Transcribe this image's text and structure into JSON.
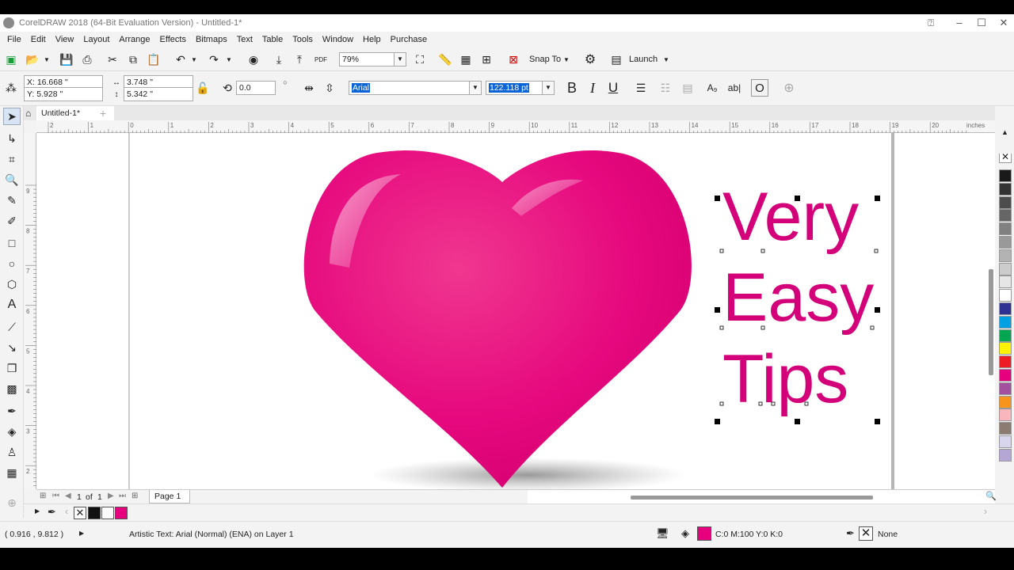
{
  "window": {
    "title": "CorelDRAW 2018 (64-Bit Evaluation Version) - Untitled-1*",
    "buttons": [
      "–",
      "☐",
      "✕"
    ]
  },
  "menu": [
    "File",
    "Edit",
    "View",
    "Layout",
    "Arrange",
    "Effects",
    "Bitmaps",
    "Text",
    "Table",
    "Tools",
    "Window",
    "Help",
    "Purchase"
  ],
  "toolbar": {
    "zoom": "79%",
    "snap_to": "Snap To",
    "launch": "Launch"
  },
  "property_bar": {
    "x": "X: 16.668 \"",
    "y": "Y: 5.928 \"",
    "width": "3.748 \"",
    "height": "5.342 \"",
    "rotation": "0.0",
    "font": "Arial",
    "font_size": "122.118 pt",
    "bold": "B",
    "italic": "I",
    "underline": "U",
    "pdf": "PDF"
  },
  "doc_tab": {
    "name": "Untitled-1*"
  },
  "ruler": {
    "h_labels": [
      "2",
      "1",
      "0",
      "1",
      "2",
      "3",
      "4",
      "5",
      "6",
      "7",
      "8",
      "9",
      "10",
      "11",
      "12",
      "13",
      "14",
      "15",
      "16",
      "17",
      "18",
      "19",
      "20"
    ],
    "units": "inches",
    "v_labels": [
      "9",
      "8",
      "7",
      "6",
      "5",
      "4",
      "3",
      "2",
      "1"
    ]
  },
  "canvas": {
    "text_lines": [
      "Very",
      "Easy",
      "Tips"
    ],
    "heart_color": "#e6087e",
    "text_color": "#d4007a"
  },
  "page_nav": {
    "current": "1",
    "of_label": "of",
    "total": "1",
    "page_tab": "Page 1"
  },
  "status": {
    "coords": "( 0.916 , 9.812 )",
    "object_info": "Artistic Text: Arial (Normal) (ENA) on Layer 1",
    "fill_info": "C:0 M:100 Y:0 K:0",
    "outline_info": "None"
  },
  "palette_colors": [
    "#1a1a1a",
    "#333333",
    "#4d4d4d",
    "#666666",
    "#808080",
    "#999999",
    "#b3b3b3",
    "#cccccc",
    "#e6e6e6",
    "#ffffff",
    "#2e3192",
    "#00a0e3",
    "#00a651",
    "#fff200",
    "#ed1c24",
    "#e6007e",
    "#a3519f",
    "#f7941d",
    "#f9b6bd",
    "#8c7b70",
    "#d8d5ee",
    "#b4a7d6"
  ],
  "doc_palette": [
    "#111111",
    "#ffffff",
    "#e6007e"
  ]
}
